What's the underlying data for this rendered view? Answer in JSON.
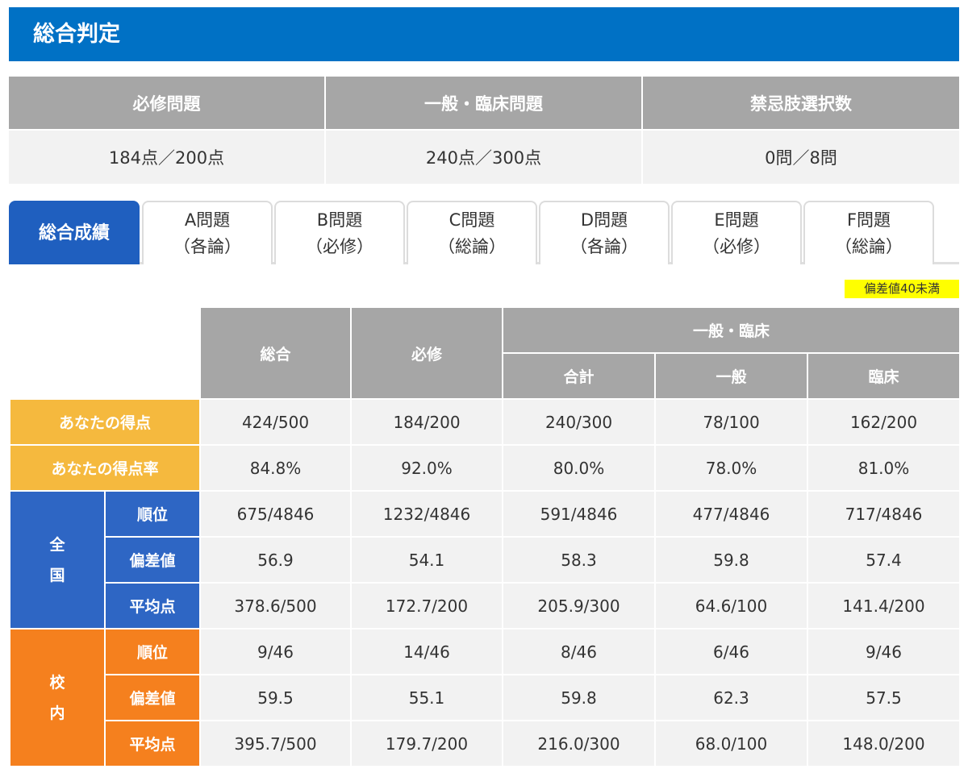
{
  "header": {
    "title": "総合判定"
  },
  "summary": {
    "headers": [
      "必修問題",
      "一般・臨床問題",
      "禁忌肢選択数"
    ],
    "values": [
      "184点／200点",
      "240点／300点",
      "0問／8問"
    ]
  },
  "tabs": [
    {
      "line1": "総合成績",
      "line2": ""
    },
    {
      "line1": "A問題",
      "line2": "（各論）"
    },
    {
      "line1": "B問題",
      "line2": "（必修）"
    },
    {
      "line1": "C問題",
      "line2": "（総論）"
    },
    {
      "line1": "D問題",
      "line2": "（各論）"
    },
    {
      "line1": "E問題",
      "line2": "（必修）"
    },
    {
      "line1": "F問題",
      "line2": "（総論）"
    }
  ],
  "legend": {
    "text": "偏差値40未満",
    "color": "#ffff00"
  },
  "results": {
    "header": {
      "total": "総合",
      "required": "必修",
      "general_clinical": "一般・臨床",
      "sum": "合計",
      "general": "一般",
      "clinical": "臨床"
    },
    "your_score": {
      "label": "あなたの得点",
      "values": [
        "424/500",
        "184/200",
        "240/300",
        "78/100",
        "162/200"
      ]
    },
    "your_rate": {
      "label": "あなたの得点率",
      "values": [
        "84.8%",
        "92.0%",
        "80.0%",
        "78.0%",
        "81.0%"
      ]
    },
    "national": {
      "group_char1": "全",
      "group_char2": "国",
      "rank": {
        "label": "順位",
        "values": [
          "675/4846",
          "1232/4846",
          "591/4846",
          "477/4846",
          "717/4846"
        ]
      },
      "deviation": {
        "label": "偏差値",
        "values": [
          "56.9",
          "54.1",
          "58.3",
          "59.8",
          "57.4"
        ]
      },
      "average": {
        "label": "平均点",
        "values": [
          "378.6/500",
          "172.7/200",
          "205.9/300",
          "64.6/100",
          "141.4/200"
        ]
      }
    },
    "school": {
      "group_char1": "校",
      "group_char2": "内",
      "rank": {
        "label": "順位",
        "values": [
          "9/46",
          "14/46",
          "8/46",
          "6/46",
          "9/46"
        ]
      },
      "deviation": {
        "label": "偏差値",
        "values": [
          "59.5",
          "55.1",
          "59.8",
          "62.3",
          "57.5"
        ]
      },
      "average": {
        "label": "平均点",
        "values": [
          "395.7/500",
          "179.7/200",
          "216.0/300",
          "68.0/100",
          "148.0/200"
        ]
      }
    }
  },
  "colors": {
    "header_blue": "#0071c5",
    "tab_active": "#1f5fbf",
    "yellow_label": "#f5b93e",
    "national_blue": "#2e66c4",
    "school_orange": "#f5801e",
    "grey_header": "#a6a6a6"
  }
}
